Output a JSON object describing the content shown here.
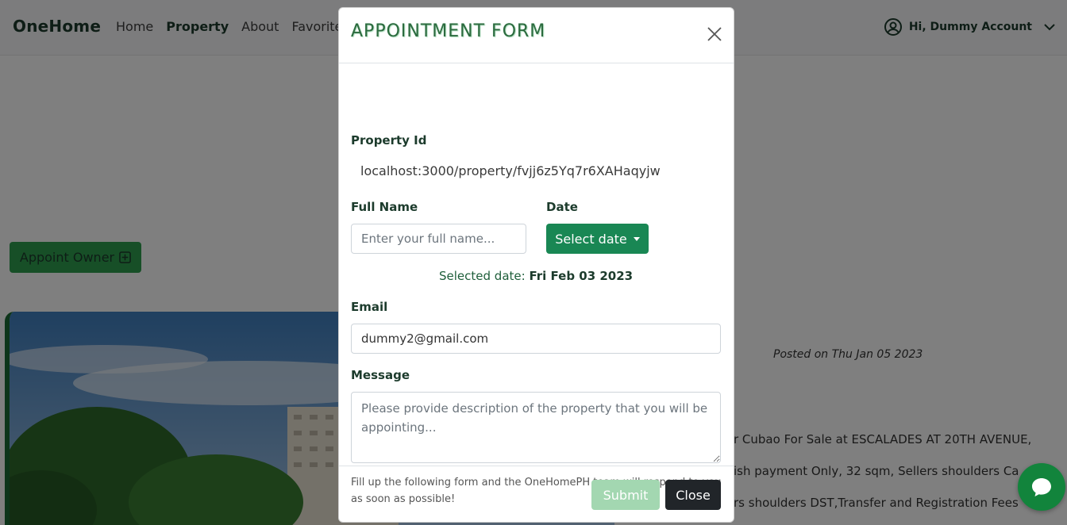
{
  "navbar": {
    "brand": "OneHome",
    "links": [
      {
        "label": "Home",
        "active": false
      },
      {
        "label": "Property",
        "active": true
      },
      {
        "label": "About",
        "active": false
      },
      {
        "label": "Favorite",
        "active": false
      }
    ],
    "user_label": "Hi, Dummy Account"
  },
  "page": {
    "appoint_button_label": "Appoint Owner",
    "posted_on": "Posted on Thu Jan 05 2023",
    "description_lines": [
      "r Cubao For Sale at ESCALADES AT 20TH AVENUE,",
      "ish payment Only, 32 sqm, Sellers shoulders Ca",
      "rs shoulders DST,Transfer and Registration Fees"
    ]
  },
  "modal": {
    "title": "APPOINTMENT FORM",
    "property_id_label": "Property Id",
    "property_id_value": "localhost:3000/property/fvjj6z5Yq7r6XAHaqyjw",
    "full_name_label": "Full Name",
    "full_name_placeholder": "Enter your full name...",
    "full_name_value": "",
    "date_label": "Date",
    "date_button_label": "Select date",
    "selected_date_prefix": "Selected date:",
    "selected_date_value": "Fri Feb 03 2023",
    "email_label": "Email",
    "email_value": "dummy2@gmail.com",
    "message_label": "Message",
    "message_placeholder": "Please provide description of the property that you will be appointing...",
    "helper_text": "Fill up the following form and the OneHomePH team will respond to you as soon as possible!",
    "submit_label": "Submit",
    "close_label": "Close"
  },
  "colors": {
    "brand_green": "#1c3b2c",
    "button_green": "#198754",
    "submit_disabled": "#a3d7b1",
    "close_dark": "#212529"
  }
}
